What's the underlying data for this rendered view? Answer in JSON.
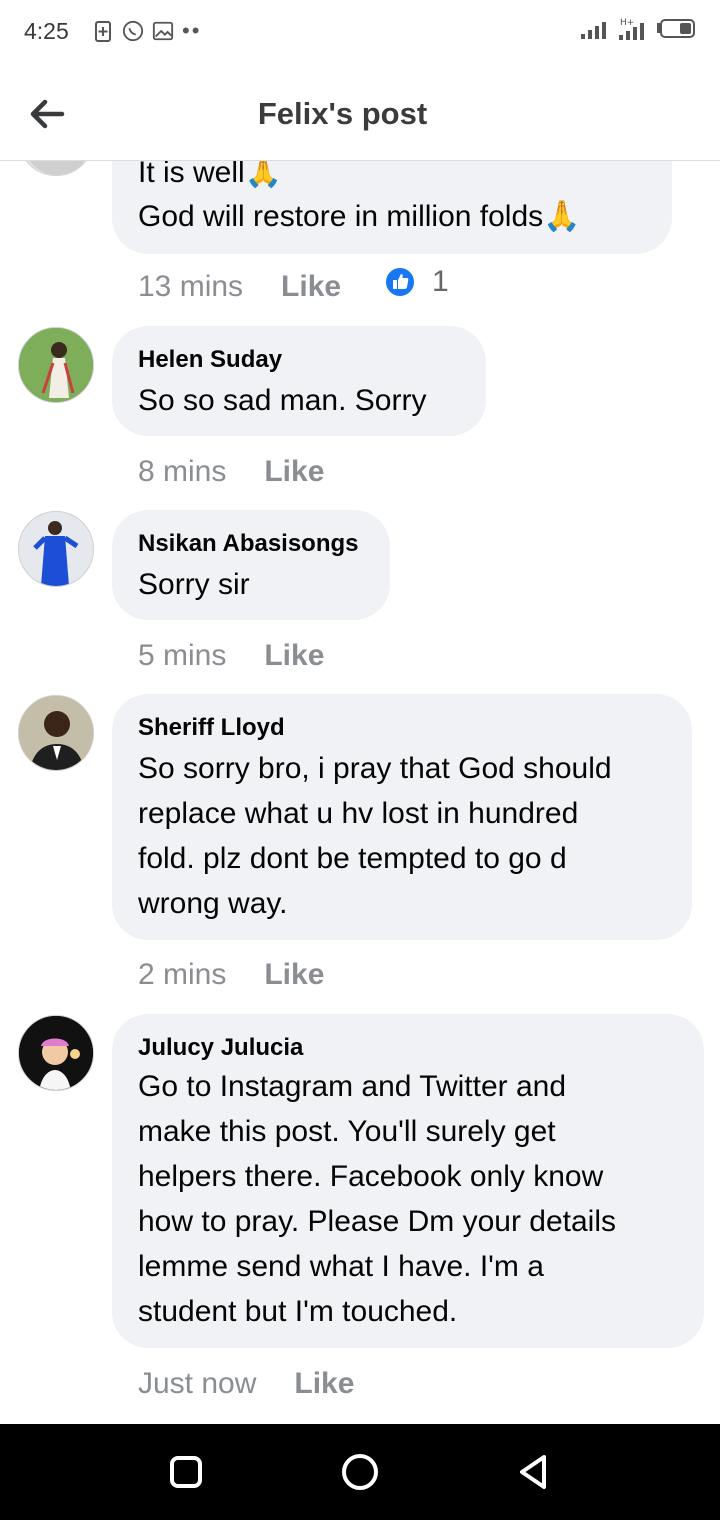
{
  "status": {
    "time": "4:25"
  },
  "header": {
    "title": "Felix's post"
  },
  "comments": [
    {
      "author": "",
      "lines": [
        "It is well🙏",
        "God will restore in million folds🙏"
      ],
      "time": "13 mins",
      "like": "Like",
      "reaction_count": "1"
    },
    {
      "author": "Helen Suday",
      "lines": [
        "So so sad man. Sorry"
      ],
      "time": "8 mins",
      "like": "Like"
    },
    {
      "author": "Nsikan Abasisongs",
      "lines": [
        "Sorry sir"
      ],
      "time": "5 mins",
      "like": "Like"
    },
    {
      "author": "Sheriff Lloyd",
      "lines": [
        "So sorry bro, i pray that God should",
        "replace what u hv lost in hundred",
        "fold. plz dont be tempted to go d",
        "wrong way."
      ],
      "time": "2 mins",
      "like": "Like"
    },
    {
      "author": "Julucy Julucia",
      "lines": [
        "Go to Instagram and Twitter and",
        "make this post. You'll surely get",
        "helpers there. Facebook only know",
        "how to pray. Please Dm your details",
        "lemme send what I have. I'm a",
        "student but I'm touched."
      ],
      "time": "Just now",
      "like": "Like"
    }
  ],
  "icons": {
    "back": "arrow-left-icon",
    "reaction": "like-reaction-icon",
    "nav": [
      "recents-square-icon",
      "home-circle-icon",
      "back-triangle-icon"
    ]
  },
  "colors": {
    "bubble": "#f0f2f5",
    "meta": "#8a8d91",
    "like_blue": "#1877f2",
    "nav_bar": "#000000"
  }
}
